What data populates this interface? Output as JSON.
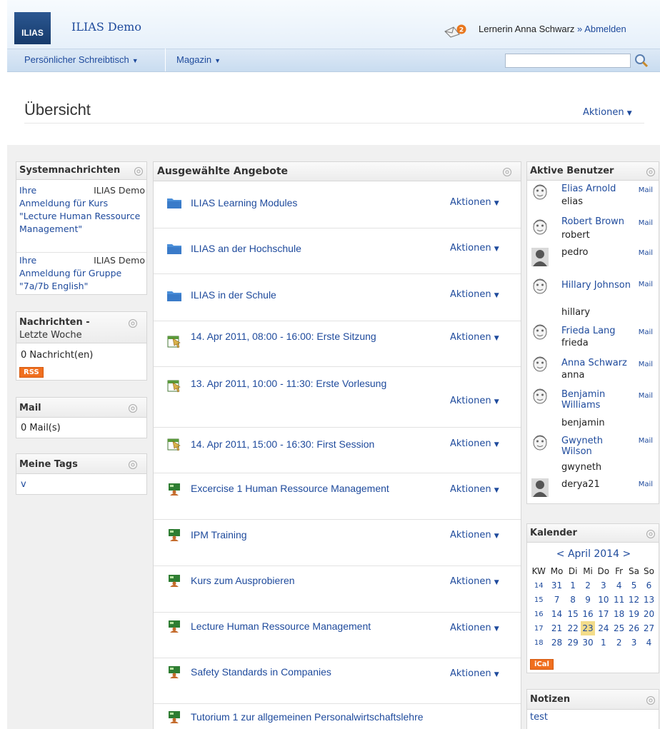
{
  "header": {
    "logo_text": "ILIAS",
    "site_title": "ILIAS Demo",
    "mail_badge": "2",
    "user_text": "Lernerin Anna Schwarz",
    "separator": "»",
    "logout": "Abmelden"
  },
  "menu": {
    "item1": "Persönlicher Schreibtisch",
    "item2": "Magazin",
    "search_placeholder": ""
  },
  "page": {
    "title": "Übersicht",
    "actions": "Aktionen"
  },
  "sysmsg": {
    "title": "Systemnachrichten",
    "items": [
      {
        "type": "Ihre",
        "source": "ILIAS Demo",
        "text": "Anmeldung für Kurs \"Lecture Human Ressource Management\""
      },
      {
        "type": "Ihre",
        "source": "ILIAS Demo",
        "text": "Anmeldung für Gruppe \"7a/7b English\""
      }
    ]
  },
  "news": {
    "title": "Nachrichten -",
    "subtitle": "Letzte Woche",
    "count": "0 Nachricht(en)",
    "rss": "RSS"
  },
  "mail": {
    "title": "Mail",
    "count": "0 Mail(s)"
  },
  "tags": {
    "title": "Meine Tags",
    "tag": "v"
  },
  "offers": {
    "title": "Ausgewählte Angebote",
    "action_label": "Aktionen",
    "items": [
      {
        "title": "ILIAS Learning Modules",
        "icon": "folder-icon"
      },
      {
        "title": "ILIAS an der Hochschule",
        "icon": "folder-icon"
      },
      {
        "title": "ILIAS in der Schule",
        "icon": "folder-icon"
      },
      {
        "title": "14. Apr 2011, 08:00 - 16:00: Erste Sitzung",
        "icon": "session-icon"
      },
      {
        "title": "13. Apr 2011, 10:00 - 11:30: Erste Vorlesung",
        "icon": "session-icon"
      },
      {
        "title": "14. Apr 2011, 15:00 - 16:30: First Session",
        "icon": "session-icon"
      },
      {
        "title": "Excercise 1 Human Ressource Management",
        "icon": "course-icon"
      },
      {
        "title": "IPM Training",
        "icon": "course-icon"
      },
      {
        "title": "Kurs zum Ausprobieren",
        "icon": "course-icon"
      },
      {
        "title": "Lecture Human Ressource Management",
        "icon": "course-icon"
      },
      {
        "title": "Safety Standards in Companies",
        "icon": "course-icon"
      },
      {
        "title": "Tutorium 1 zur allgemeinen Personalwirtschaftslehre",
        "icon": "course-icon"
      }
    ]
  },
  "users": {
    "title": "Aktive Benutzer",
    "mail_label": "Mail",
    "items": [
      {
        "name": "Elias Arnold",
        "login": "elias"
      },
      {
        "name": "Robert Brown",
        "login": "robert"
      },
      {
        "name": "",
        "login": "pedro"
      },
      {
        "name": "Hillary Johnson",
        "login": "hillary"
      },
      {
        "name": "Frieda Lang",
        "login": "frieda"
      },
      {
        "name": "Anna Schwarz",
        "login": "anna"
      },
      {
        "name": "Benjamin Williams",
        "login": "benjamin"
      },
      {
        "name": "Gwyneth Wilson",
        "login": "gwyneth"
      },
      {
        "name": "",
        "login": "derya21"
      }
    ]
  },
  "calendar": {
    "title": "Kalender",
    "nav_prev": "<",
    "month": "April 2014",
    "nav_next": ">",
    "ical": "iCal",
    "head": [
      "KW",
      "Mo",
      "Di",
      "Mi",
      "Do",
      "Fr",
      "Sa",
      "So"
    ],
    "weeks": [
      [
        "14",
        "31",
        "1",
        "2",
        "3",
        "4",
        "5",
        "6"
      ],
      [
        "15",
        "7",
        "8",
        "9",
        "10",
        "11",
        "12",
        "13"
      ],
      [
        "16",
        "14",
        "15",
        "16",
        "17",
        "18",
        "19",
        "20"
      ],
      [
        "17",
        "21",
        "22",
        "23",
        "24",
        "25",
        "26",
        "27"
      ],
      [
        "18",
        "28",
        "29",
        "30",
        "1",
        "2",
        "3",
        "4"
      ]
    ],
    "today": "23"
  },
  "notes": {
    "title": "Notizen",
    "item": "test"
  },
  "colors": {
    "link": "#1e4a9c",
    "header_bg": "#e6f0fa",
    "menu_bg": "#c9dcf0",
    "rss": "#f06f1f",
    "today": "#f3dc8a"
  }
}
